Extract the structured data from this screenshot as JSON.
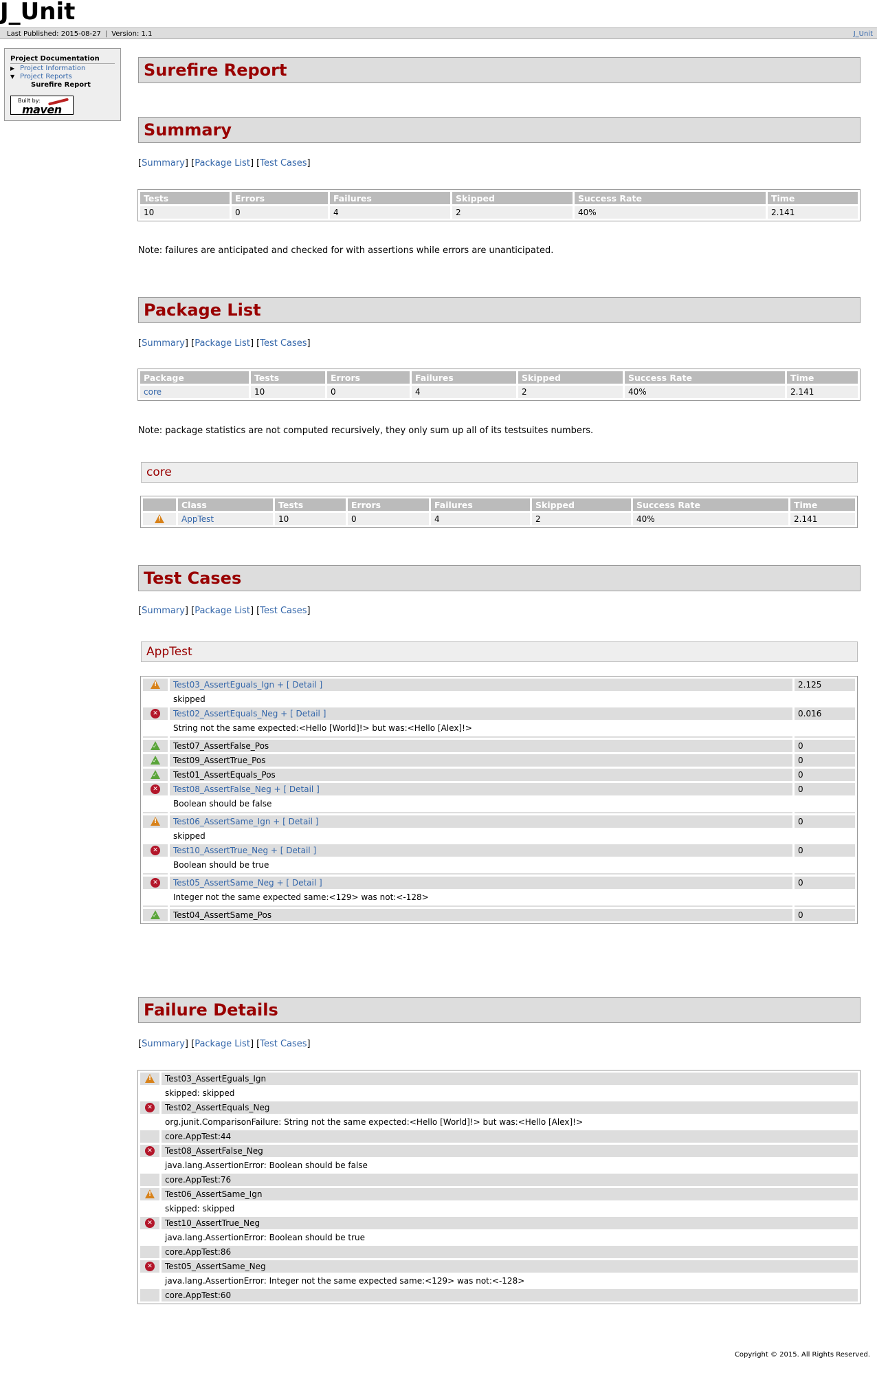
{
  "banner": {
    "title": "J_Unit"
  },
  "breadcrumbs": {
    "published": "Last Published: 2015-08-27",
    "version": "Version: 1.1",
    "right_link": "J_Unit"
  },
  "menu": {
    "heading": "Project Documentation",
    "items": [
      "Project Information",
      "Project Reports",
      "Surefire Report"
    ],
    "logo_built": "Built by:",
    "logo_maven": "maven"
  },
  "sections": {
    "report_title": "Surefire Report",
    "summary_title": "Summary",
    "package_list_title": "Package List",
    "test_cases_title": "Test Cases",
    "failure_details_title": "Failure Details"
  },
  "nav": {
    "summary": "Summary",
    "package_list": "Package List",
    "test_cases": "Test Cases"
  },
  "summary": {
    "headers": [
      "Tests",
      "Errors",
      "Failures",
      "Skipped",
      "Success Rate",
      "Time"
    ],
    "values": [
      "10",
      "0",
      "4",
      "2",
      "40%",
      "2.141"
    ],
    "note": "Note: failures are anticipated and checked for with assertions while errors are unanticipated."
  },
  "package_list": {
    "headers": [
      "Package",
      "Tests",
      "Errors",
      "Failures",
      "Skipped",
      "Success Rate",
      "Time"
    ],
    "values": [
      "core",
      "10",
      "0",
      "4",
      "2",
      "40%",
      "2.141"
    ],
    "note": "Note: package statistics are not computed recursively, they only sum up all of its testsuites numbers."
  },
  "core_package": {
    "title": "core",
    "headers": [
      "Class",
      "Tests",
      "Errors",
      "Failures",
      "Skipped",
      "Success Rate",
      "Time"
    ],
    "values": [
      "AppTest",
      "10",
      "0",
      "4",
      "2",
      "40%",
      "2.141"
    ]
  },
  "apptest": {
    "title": "AppTest",
    "detail_suffix": " + [ Detail ]",
    "cases": [
      {
        "name": "Test03_AssertEguals_Ign",
        "status": "warn",
        "time": "2.125",
        "message": "skipped"
      },
      {
        "name": "Test02_AssertEquals_Neg",
        "status": "err",
        "time": "0.016",
        "message": "String not the same expected:<Hello [World]!> but was:<Hello [Alex]!>"
      },
      {
        "name": "Test07_AssertFalse_Pos",
        "status": "ok",
        "time": "0",
        "message": ""
      },
      {
        "name": "Test09_AssertTrue_Pos",
        "status": "ok",
        "time": "0",
        "message": ""
      },
      {
        "name": "Test01_AssertEquals_Pos",
        "status": "ok",
        "time": "0",
        "message": ""
      },
      {
        "name": "Test08_AssertFalse_Neg",
        "status": "err",
        "time": "0",
        "message": "Boolean should be false"
      },
      {
        "name": "Test06_AssertSame_Ign",
        "status": "warn",
        "time": "0",
        "message": "skipped"
      },
      {
        "name": "Test10_AssertTrue_Neg",
        "status": "err",
        "time": "0",
        "message": "Boolean should be true"
      },
      {
        "name": "Test05_AssertSame_Neg",
        "status": "err",
        "time": "0",
        "message": "Integer not the same expected same:<129> was not:<-128>"
      },
      {
        "name": "Test04_AssertSame_Pos",
        "status": "ok",
        "time": "0",
        "message": ""
      }
    ]
  },
  "failure_details": [
    {
      "name": "Test03_AssertEguals_Ign",
      "status": "warn",
      "lines": [
        "skipped: skipped"
      ]
    },
    {
      "name": "Test02_AssertEquals_Neg",
      "status": "err",
      "lines": [
        "org.junit.ComparisonFailure: String not the same expected:<Hello [World]!> but was:<Hello [Alex]!>",
        "core.AppTest:44"
      ]
    },
    {
      "name": "Test08_AssertFalse_Neg",
      "status": "err",
      "lines": [
        "java.lang.AssertionError: Boolean should be false",
        "core.AppTest:76"
      ]
    },
    {
      "name": "Test06_AssertSame_Ign",
      "status": "warn",
      "lines": [
        "skipped: skipped"
      ]
    },
    {
      "name": "Test10_AssertTrue_Neg",
      "status": "err",
      "lines": [
        "java.lang.AssertionError: Boolean should be true",
        "core.AppTest:86"
      ]
    },
    {
      "name": "Test05_AssertSame_Neg",
      "status": "err",
      "lines": [
        "java.lang.AssertionError: Integer not the same expected same:<129> was not:<-128>",
        "core.AppTest:60"
      ]
    }
  ],
  "footer": "Copyright © 2015. All Rights Reserved.",
  "colors": {
    "heading": "#990000",
    "link": "#3366aa",
    "error": "#b3162a",
    "warning": "#d8821a",
    "success": "#5aa43a"
  }
}
